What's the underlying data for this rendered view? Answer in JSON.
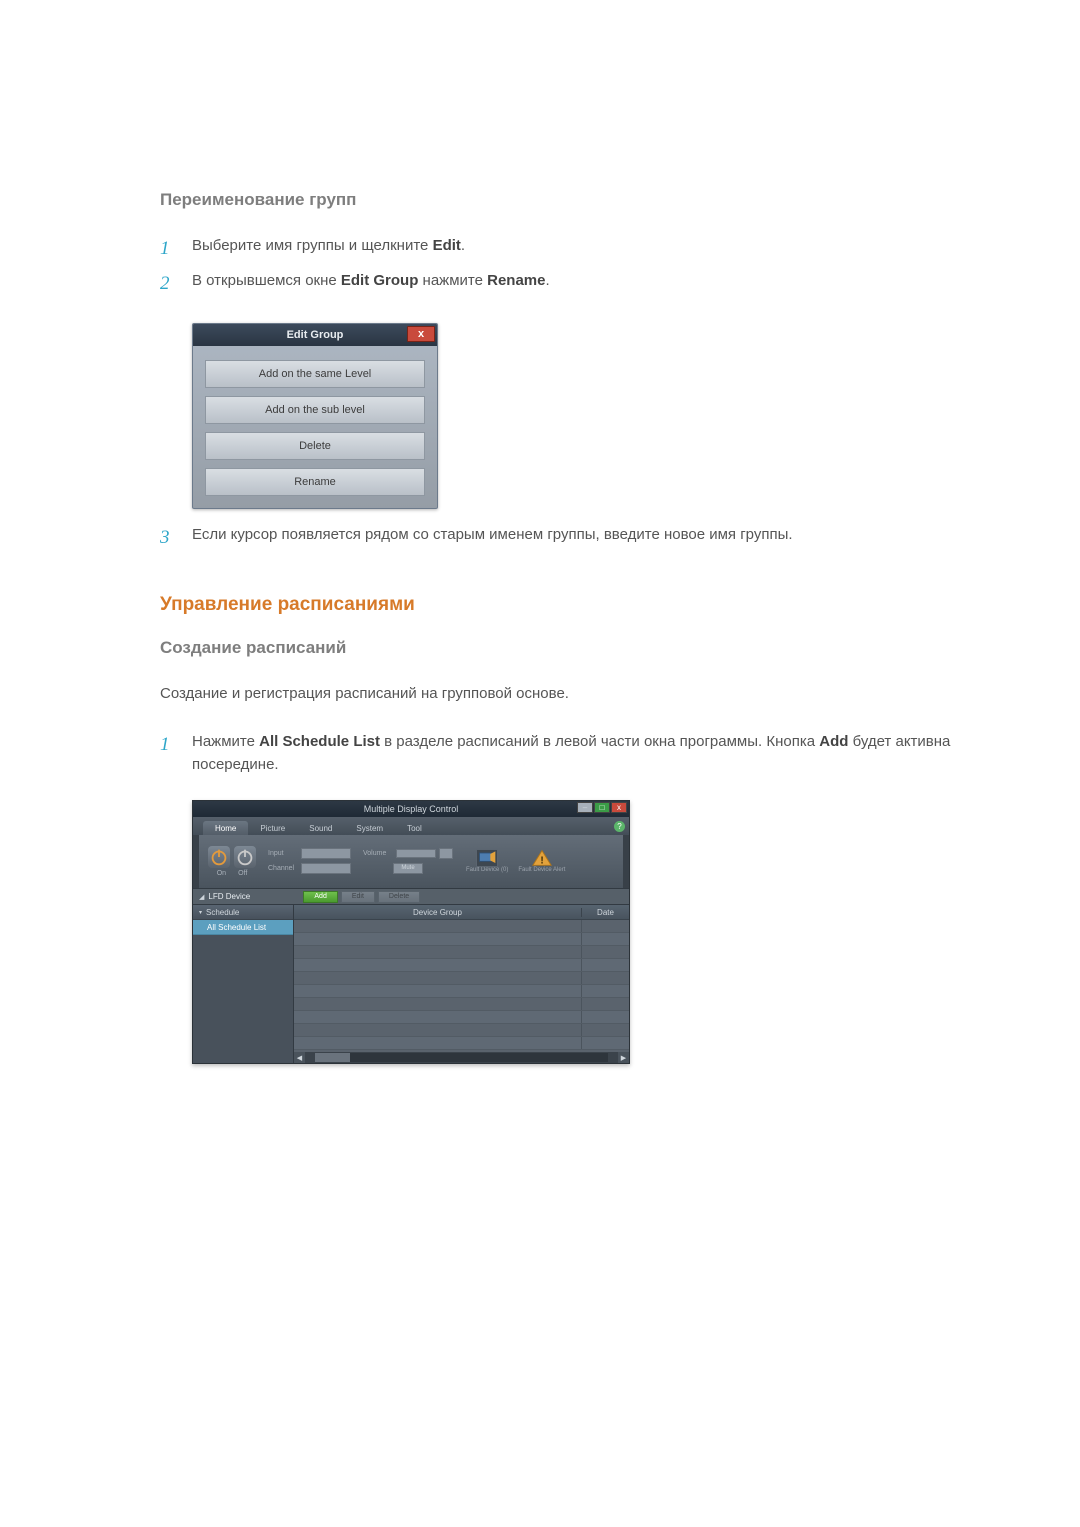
{
  "rename_groups": {
    "heading": "Переименование групп",
    "steps": [
      {
        "num": "1",
        "pre": "Выберите имя группы и щелкните ",
        "bold": "Edit",
        "post": "."
      },
      {
        "num": "2",
        "pre": "В открывшемся окне ",
        "bold": "Edit Group",
        "mid": " нажмите ",
        "bold2": "Rename",
        "post": "."
      },
      {
        "num": "3",
        "pre": "Если курсор появляется рядом со старым именем группы, введите новое имя группы."
      }
    ]
  },
  "dialog": {
    "title": "Edit Group",
    "close": "x",
    "buttons": [
      "Add on the same Level",
      "Add on the sub level",
      "Delete",
      "Rename"
    ]
  },
  "schedules": {
    "section_title": "Управление расписаниями",
    "sub_heading": "Создание расписаний",
    "intro": "Создание и регистрация расписаний на групповой основе.",
    "step1": {
      "num": "1",
      "pre": "Нажмите ",
      "bold": "All Schedule List",
      "mid": " в разделе расписаний в левой части окна программы. Кнопка ",
      "bold2": "Add",
      "post": " будет активна посередине."
    }
  },
  "mdc": {
    "title": "Multiple Display Control",
    "help": "?",
    "win": {
      "min": "–",
      "max": "□",
      "close": "x"
    },
    "tabs": [
      "Home",
      "Picture",
      "Sound",
      "System",
      "Tool"
    ],
    "active_tab": 0,
    "tools": {
      "power_on": "On",
      "power_off": "Off",
      "input_label": "Input",
      "input_value": "",
      "channel_label": "Channel",
      "channel_value": "",
      "volume_label": "Volume",
      "volume_value": "",
      "mute_label": "Mute",
      "fault0_label": "Fault Device (0)",
      "fault_alert_label": "Fault Device Alert"
    },
    "actions": {
      "add": "Add",
      "edit": "Edit",
      "delete": "Delete"
    },
    "sidebar": {
      "collapsed_label": "LFD Device",
      "section": "Schedule",
      "item": "All Schedule List"
    },
    "grid": {
      "col_device": "Device Group",
      "col_date": "Date",
      "rows": 10
    }
  }
}
